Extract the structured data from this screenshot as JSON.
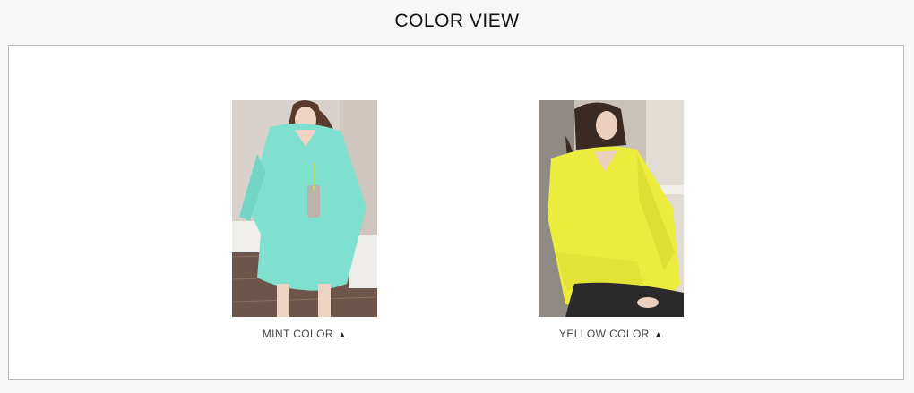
{
  "section": {
    "title": "COLOR VIEW"
  },
  "swatches": [
    {
      "label": "MINT COLOR",
      "marker": "▲",
      "garment_color": "#7fe0cf"
    },
    {
      "label": "YELLOW COLOR",
      "marker": "▲",
      "garment_color": "#ecec3c"
    }
  ]
}
